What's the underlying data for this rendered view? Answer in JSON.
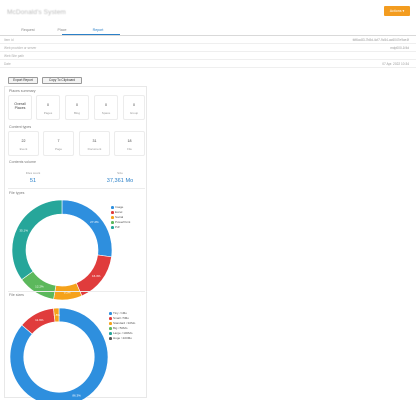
{
  "header": {
    "title": "McDonald's System",
    "actions_label": "Actions ▾"
  },
  "tabs": [
    {
      "label": "Request"
    },
    {
      "label": "Place"
    },
    {
      "label": "Report",
      "active": true
    }
  ],
  "info_rows": [
    {
      "key": "Item id",
      "value": "fdf6cc83-7b8d-4cf7-9c54-ac6047e9ce4f"
    },
    {
      "key": "Web provider or server",
      "value": "mdp000-1f4d"
    },
    {
      "key": "Web Site path",
      "value": ""
    },
    {
      "key": "Date",
      "value": "07 Apr. 2022 10:34"
    }
  ],
  "buttons": {
    "export_label": "Export Report",
    "copy_label": "Copy To Clipboard"
  },
  "places_summary": {
    "title": "Places summary",
    "cards": [
      {
        "num": "Overall Places",
        "label": ""
      },
      {
        "num": "0",
        "label": "Pages"
      },
      {
        "num": "0",
        "label": "Blog"
      },
      {
        "num": "0",
        "label": "Space"
      },
      {
        "num": "0",
        "label": "Group"
      }
    ]
  },
  "content_types": {
    "title": "Content types",
    "cards": [
      {
        "num": "22",
        "label": "Event"
      },
      {
        "num": "7",
        "label": "Page"
      },
      {
        "num": "31",
        "label": "Document"
      },
      {
        "num": "18",
        "label": "File"
      }
    ]
  },
  "contents_volume": {
    "title": "Contents volume",
    "files_label": "Files count",
    "files_value": "51",
    "size_label": "Size",
    "size_value": "37,361 Mo"
  },
  "chart_data": [
    {
      "type": "pie",
      "title": "File types",
      "categories": [
        "Image",
        "Excel",
        "Social",
        "PowerPoint",
        "Pdf"
      ],
      "values": [
        27.2,
        16.3,
        9.2,
        12.2,
        35.1
      ],
      "colors": [
        "#2e8fde",
        "#e03c3c",
        "#f5a21b",
        "#5cb85c",
        "#26a69a"
      ],
      "legend": "right"
    },
    {
      "type": "pie",
      "title": "File sizes",
      "categories": [
        "Tiny <1Mo",
        "Small <5Mo",
        "Standard <10Mo",
        "Big <50Mo",
        "Large <100Mo",
        "Huge >100Mo"
      ],
      "values": [
        86.3,
        11.9,
        1.8,
        0,
        0,
        0
      ],
      "colors": [
        "#2e8fde",
        "#e03c3c",
        "#f5a21b",
        "#5cb85c",
        "#26a69a",
        "#555555"
      ],
      "legend": "right"
    }
  ]
}
